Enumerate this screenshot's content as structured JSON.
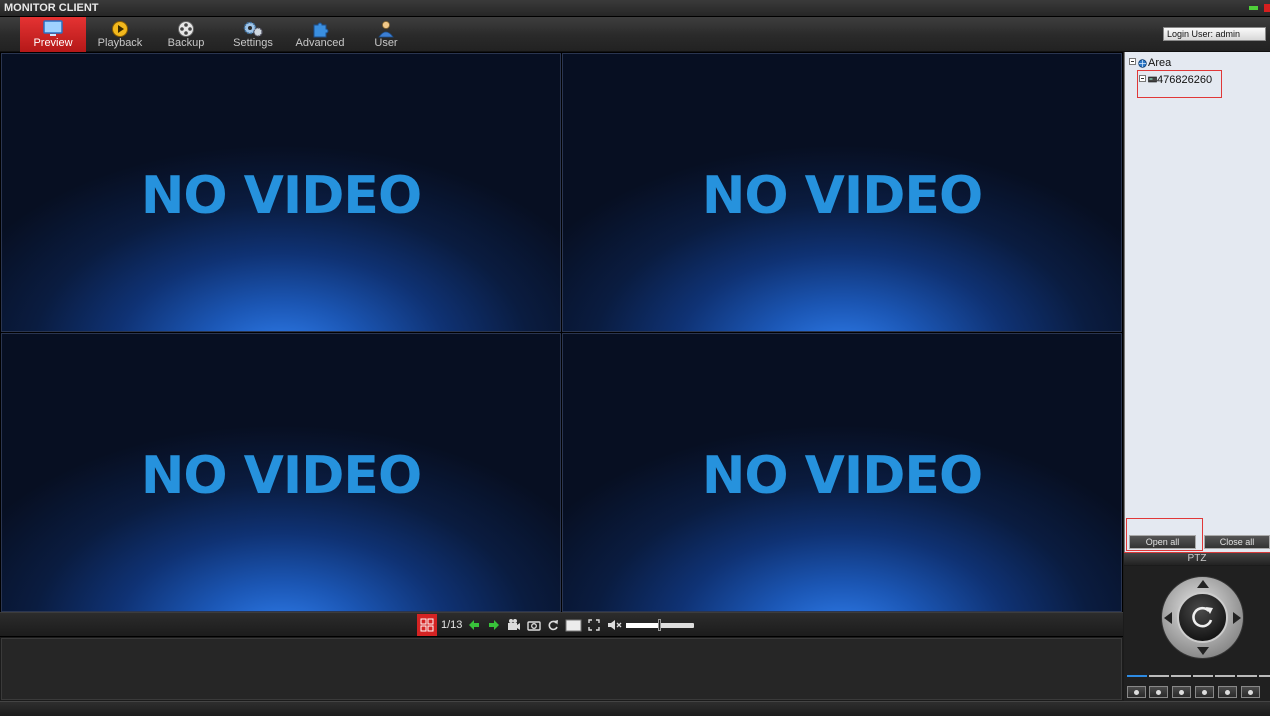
{
  "window": {
    "title": "MONITOR CLIENT",
    "min_icon": "minimize-icon",
    "close_icon": "close-icon"
  },
  "toolbar": {
    "items": [
      {
        "label": "Preview",
        "icon": "monitor-icon",
        "active": true
      },
      {
        "label": "Playback",
        "icon": "play-icon",
        "active": false
      },
      {
        "label": "Backup",
        "icon": "film-reel-icon",
        "active": false
      },
      {
        "label": "Settings",
        "icon": "gears-icon",
        "active": false
      },
      {
        "label": "Advanced",
        "icon": "puzzle-icon",
        "active": false
      },
      {
        "label": "User",
        "icon": "user-icon",
        "active": false
      }
    ],
    "login_user": "Login User: admin"
  },
  "video": {
    "tiles": [
      "NO VIDEO",
      "NO VIDEO",
      "NO VIDEO",
      "NO VIDEO"
    ]
  },
  "controls": {
    "page": "1/13",
    "icons": [
      "layout-grid-icon",
      "prev-arrow-icon",
      "next-arrow-icon",
      "record-icon",
      "snapshot-icon",
      "refresh-icon",
      "stop-icon",
      "fullscreen-icon",
      "mute-icon"
    ],
    "volume_fraction": 0.48
  },
  "device_tree": {
    "root": "Area",
    "device": "476826260"
  },
  "panel_buttons": {
    "open_all": "Open all",
    "close_all": "Close all"
  },
  "ptz": {
    "title": "PTZ",
    "center_icon": "rotate-icon"
  },
  "colors": {
    "accent_red": "#d42323",
    "no_video_text": "#2692dd",
    "active_green": "#4fcf3a"
  }
}
